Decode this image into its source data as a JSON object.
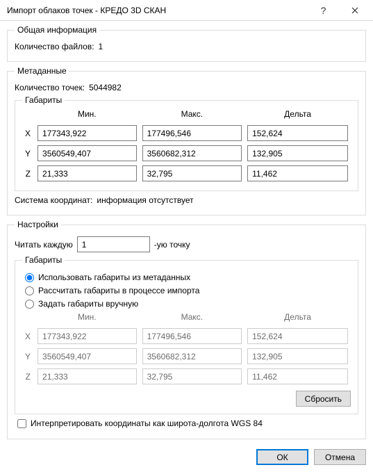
{
  "window": {
    "title": "Импорт облаков точек - КРЕДО 3D СКАН"
  },
  "general": {
    "legend": "Общая информация",
    "files_label": "Количество файлов:",
    "files_value": "1"
  },
  "meta": {
    "legend": "Метаданные",
    "points_label": "Количество точек:",
    "points_value": "5044982",
    "bounds_legend": "Габариты",
    "col_min": "Мин.",
    "col_max": "Макс.",
    "col_delta": "Дельта",
    "axis_x": "X",
    "axis_y": "Y",
    "axis_z": "Z",
    "x": {
      "min": "177343,922",
      "max": "177496,546",
      "delta": "152,624"
    },
    "y": {
      "min": "3560549,407",
      "max": "3560682,312",
      "delta": "132,905"
    },
    "z": {
      "min": "21,333",
      "max": "32,795",
      "delta": "11,462"
    },
    "cs_label": "Система координат:",
    "cs_value": "информация отсутствует"
  },
  "settings": {
    "legend": "Настройки",
    "read_every_a": "Читать каждую",
    "read_every_value": "1",
    "read_every_b": "-ую точку",
    "bounds_legend": "Габариты",
    "radio_meta": "Использовать габариты из метаданных",
    "radio_calc": "Рассчитать габариты в процессе импорта",
    "radio_manual": "Задать габариты вручную",
    "col_min": "Мин.",
    "col_max": "Макс.",
    "col_delta": "Дельта",
    "axis_x": "X",
    "axis_y": "Y",
    "axis_z": "Z",
    "x": {
      "min": "177343,922",
      "max": "177496,546",
      "delta": "152,624"
    },
    "y": {
      "min": "3560549,407",
      "max": "3560682,312",
      "delta": "132,905"
    },
    "z": {
      "min": "21,333",
      "max": "32,795",
      "delta": "11,462"
    },
    "reset_btn": "Сбросить",
    "wgs84_check": "Интерпретировать координаты как широта-долгота WGS 84"
  },
  "footer": {
    "ok": "ОК",
    "cancel": "Отмена"
  }
}
